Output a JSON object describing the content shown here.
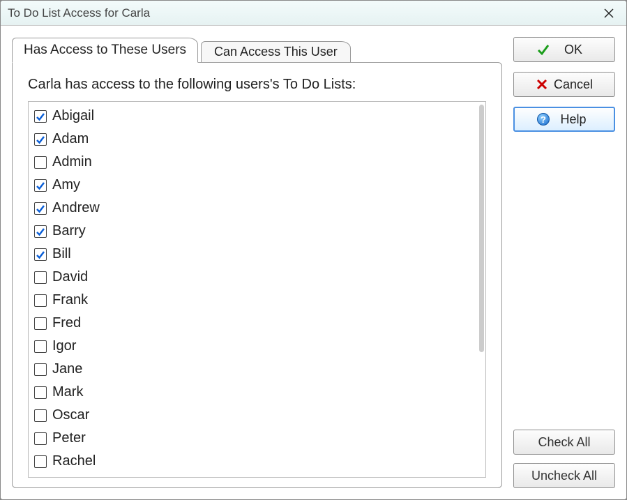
{
  "window": {
    "title": "To Do List Access for Carla"
  },
  "tabs": {
    "active": "Has Access to These Users",
    "inactive": "Can Access This User"
  },
  "panel": {
    "description": "Carla has access to the following users's To Do Lists:"
  },
  "users": [
    {
      "name": "Abigail",
      "checked": true
    },
    {
      "name": "Adam",
      "checked": true
    },
    {
      "name": "Admin",
      "checked": false
    },
    {
      "name": "Amy",
      "checked": true
    },
    {
      "name": "Andrew",
      "checked": true
    },
    {
      "name": "Barry",
      "checked": true
    },
    {
      "name": "Bill",
      "checked": true
    },
    {
      "name": "David",
      "checked": false
    },
    {
      "name": "Frank",
      "checked": false
    },
    {
      "name": "Fred",
      "checked": false
    },
    {
      "name": "Igor",
      "checked": false
    },
    {
      "name": "Jane",
      "checked": false
    },
    {
      "name": "Mark",
      "checked": false
    },
    {
      "name": "Oscar",
      "checked": false
    },
    {
      "name": "Peter",
      "checked": false
    },
    {
      "name": "Rachel",
      "checked": false
    }
  ],
  "buttons": {
    "ok": "OK",
    "cancel": "Cancel",
    "help": "Help",
    "check_all": "Check All",
    "uncheck_all": "Uncheck All"
  }
}
